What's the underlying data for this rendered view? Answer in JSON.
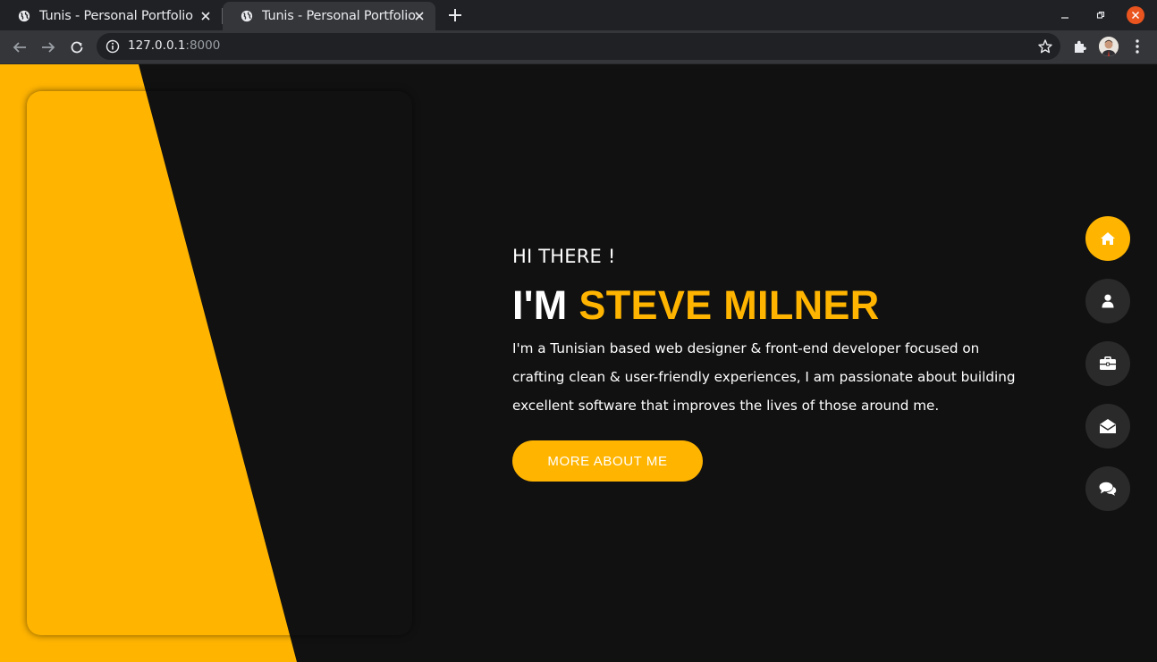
{
  "browser": {
    "tabs": [
      {
        "title": "Tunis - Personal Portfolio",
        "active": false
      },
      {
        "title": "Tunis - Personal Portfolio",
        "active": true
      }
    ],
    "url_host": "127.0.0.1",
    "url_port": ":8000"
  },
  "hero": {
    "greeting": "HI THERE !",
    "name_prefix": "I'M ",
    "name_highlight": "STEVE MILNER",
    "bio": "I'm a Tunisian based web designer & front-end developer focused on crafting clean & user-friendly experiences, I am passionate about building excellent software that improves the lives of those around me.",
    "cta_label": "MORE ABOUT ME"
  },
  "sidenav": {
    "items": [
      {
        "icon": "home-icon",
        "active": true
      },
      {
        "icon": "user-icon",
        "active": false
      },
      {
        "icon": "briefcase-icon",
        "active": false
      },
      {
        "icon": "envelope-open-icon",
        "active": false
      },
      {
        "icon": "comments-icon",
        "active": false
      }
    ]
  },
  "colors": {
    "accent": "#ffb400",
    "background": "#111111",
    "nav_circle": "#2b2a2a"
  }
}
